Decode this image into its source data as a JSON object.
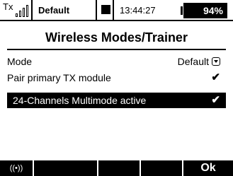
{
  "status": {
    "tx_label": "Tx",
    "model_name": "Default",
    "time": "13:44:27",
    "battery": "94%"
  },
  "title": "Wireless Modes/Trainer",
  "rows": [
    {
      "label": "Mode",
      "value": "Default"
    },
    {
      "label": "Pair primary TX module",
      "value": "✔"
    },
    {
      "label": "24-Channels Multimode active",
      "value": "✔"
    }
  ],
  "softkeys": {
    "wireless_icon": "((•))",
    "ok": "Ok"
  },
  "colors": {
    "foreground": "#000000",
    "background": "#ffffff"
  }
}
